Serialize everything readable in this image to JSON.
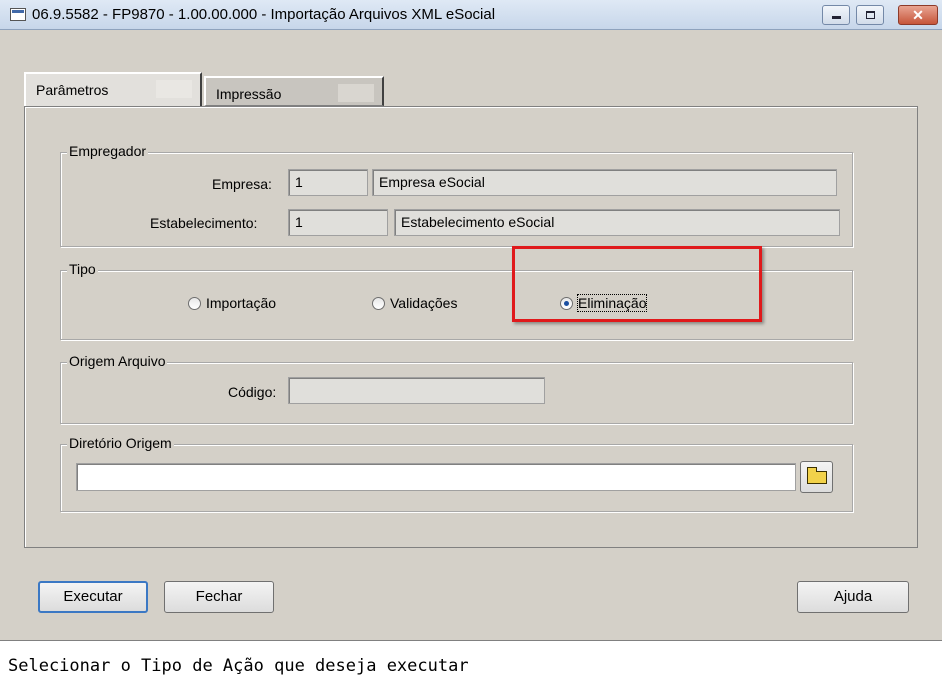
{
  "window": {
    "title": "06.9.5582 - FP9870 - 1.00.00.000 - Importação Arquivos XML eSocial",
    "controls": {
      "minimize": "minimize-icon",
      "maximize": "maximize-icon",
      "close": "close-icon"
    }
  },
  "tabs": [
    {
      "label": "Parâmetros",
      "active": true
    },
    {
      "label": "Impressão",
      "active": false
    }
  ],
  "empregador": {
    "legend": "Empregador",
    "empresa_label": "Empresa:",
    "empresa_code": "1",
    "empresa_name": "Empresa eSocial",
    "estab_label": "Estabelecimento:",
    "estab_code": "1",
    "estab_name": "Estabelecimento eSocial"
  },
  "tipo": {
    "legend": "Tipo",
    "options": [
      {
        "label": "Importação",
        "selected": false
      },
      {
        "label": "Validações",
        "selected": false
      },
      {
        "label": "Eliminação",
        "selected": true
      }
    ],
    "highlight_color": "#e0191b"
  },
  "origem": {
    "legend": "Origem Arquivo",
    "codigo_label": "Código:",
    "codigo_value": ""
  },
  "diretorio": {
    "legend": "Diretório Origem",
    "path_value": "",
    "browse_icon": "folder-icon"
  },
  "buttons": {
    "executar": "Executar",
    "fechar": "Fechar",
    "ajuda": "Ajuda"
  },
  "status": {
    "text": "Selecionar o Tipo de Ação que deseja executar"
  }
}
